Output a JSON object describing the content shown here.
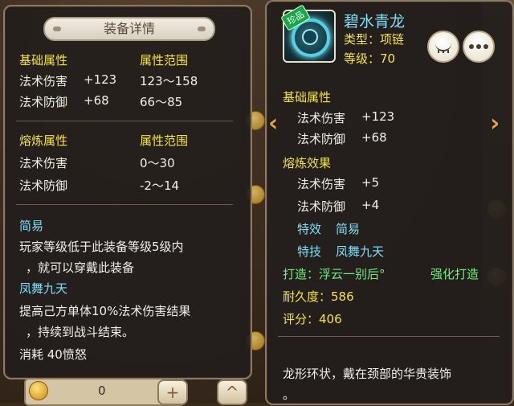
{
  "left_panel": {
    "title": "装备详情",
    "base_header": "基础属性",
    "base_range_header": "属性范围",
    "base_rows": [
      {
        "name": "法术伤害",
        "value": "+123",
        "range": "123～158"
      },
      {
        "name": "法术防御",
        "value": "+68",
        "range": "66～85"
      }
    ],
    "smelt_header": "熔炼属性",
    "smelt_range_header": "属性范围",
    "smelt_rows": [
      {
        "name": "法术伤害",
        "range": "0～30"
      },
      {
        "name": "法术防御",
        "range": "-2～14"
      }
    ],
    "special_effect_name": "简易",
    "special_effect_desc_1": "玩家等级低于此装备等级5级内",
    "special_effect_desc_2": "，就可以穿戴此装备",
    "skill_name": "凤舞九天",
    "skill_desc_1": "提高己方单体10%法术伤害结果",
    "skill_desc_2": "，持续到战斗结束。",
    "skill_cost": "消耗 40愤怒"
  },
  "right_panel": {
    "item_name": "碧水青龙",
    "badge": "珍品",
    "type_label": "类型：项链",
    "level_label": "等级：70",
    "base_header": "基础属性",
    "base_rows": [
      {
        "name": "法术伤害",
        "value": "+123"
      },
      {
        "name": "法术防御",
        "value": "+68"
      }
    ],
    "smelt_header": "熔炼效果",
    "smelt_rows": [
      {
        "name": "法术伤害",
        "value": "+5"
      },
      {
        "name": "法术防御",
        "value": "+4"
      }
    ],
    "special_label": "特效",
    "special_value": "简易",
    "skill_label": "特技",
    "skill_value": "凤舞九天",
    "forge_label": "打造：浮云一别后°",
    "enhance_label": "强化打造",
    "durability": "耐久度：586",
    "score": "评分：406",
    "description": "龙形环状，戴在颈部的华贵装饰",
    "description_tail": "。"
  },
  "bottom": {
    "count": "0"
  },
  "colors": {
    "yellow": "#f3e34a",
    "cyan": "#7fe0f6",
    "green": "#6ef07a",
    "white": "#f2efe8"
  },
  "icons": [
    "eye-closed-icon",
    "more-icon",
    "chevron-left-icon",
    "chevron-right-icon",
    "coin-icon",
    "plus-icon",
    "chevron-up-icon"
  ]
}
